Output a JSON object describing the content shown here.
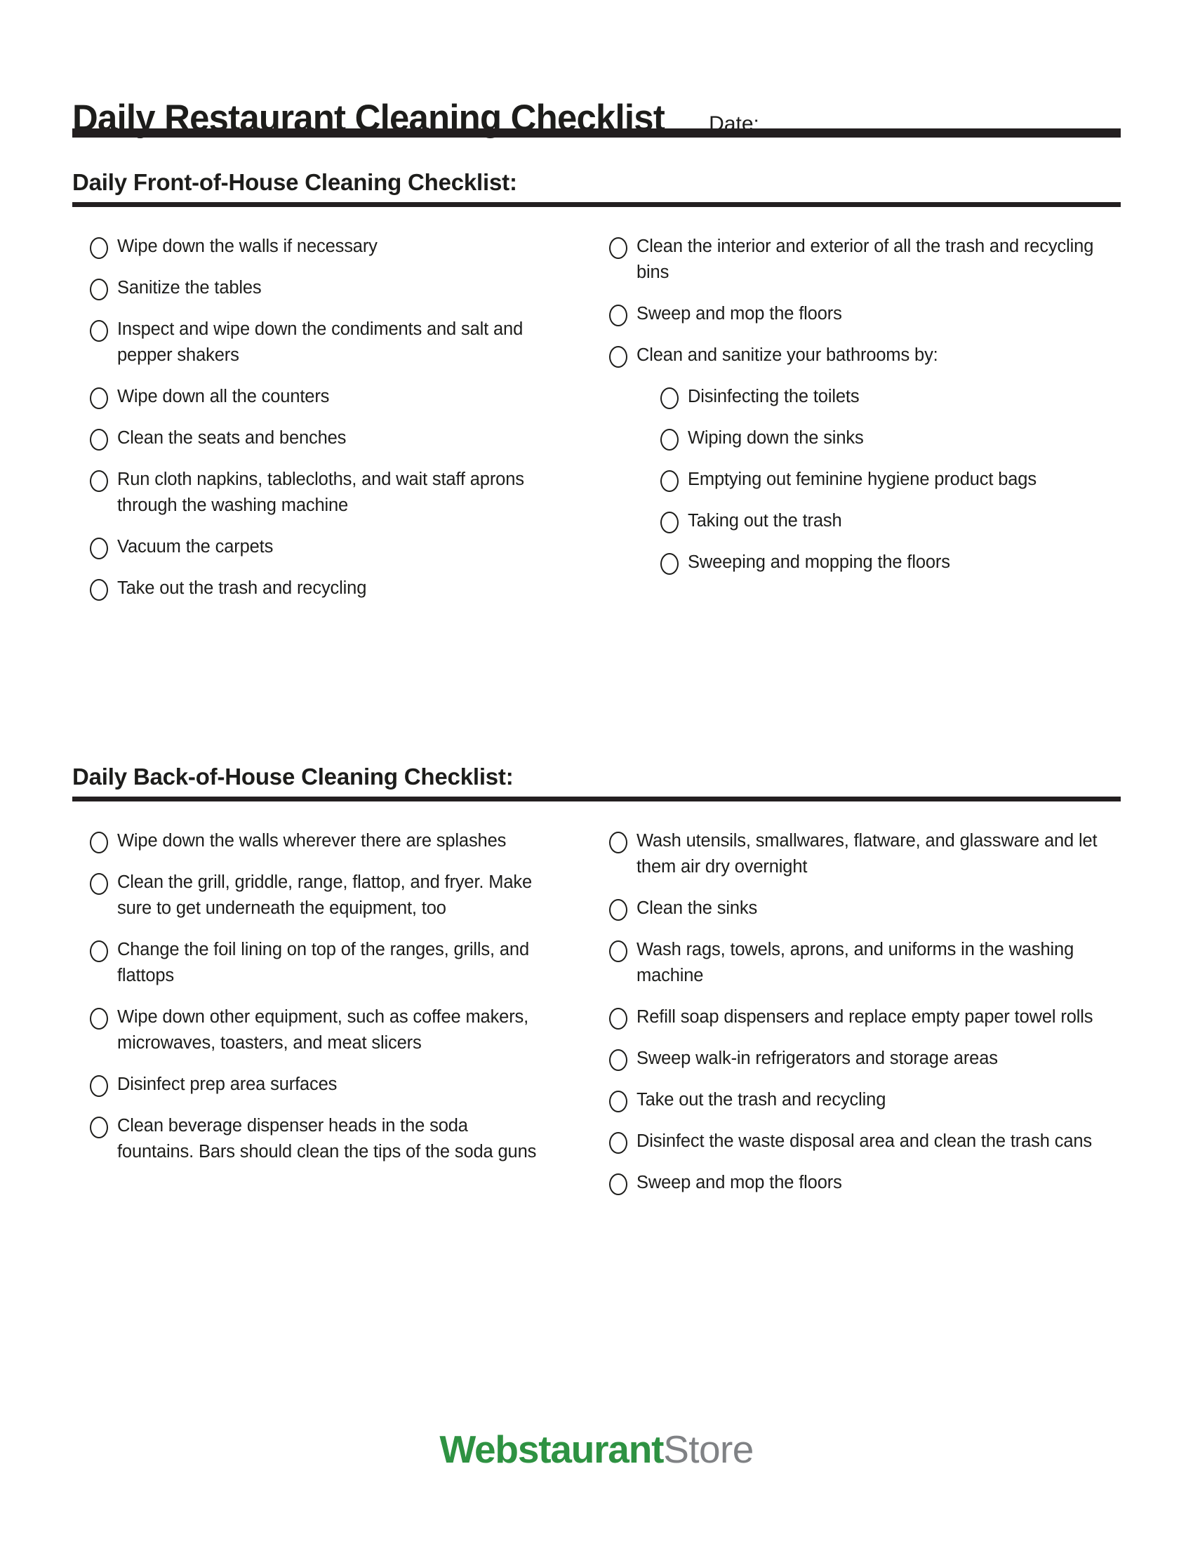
{
  "document": {
    "title": "Daily Restaurant Cleaning Checklist",
    "date_label": "Date:",
    "date_value": ""
  },
  "colors": {
    "rule": "#231f20",
    "text": "#1d1d1b",
    "logo_green": "#2e9242",
    "logo_gray": "#808285"
  },
  "sections": [
    {
      "heading": "Daily Front-of-House Cleaning Checklist:",
      "left_column": [
        {
          "label": "Wipe down the walls if necessary",
          "level": 0
        },
        {
          "label": "Sanitize the tables",
          "level": 0
        },
        {
          "label": "Inspect and wipe down the condiments and salt and pepper shakers",
          "level": 0
        },
        {
          "label": "Wipe down all the counters",
          "level": 0
        },
        {
          "label": "Clean the seats and benches",
          "level": 0
        },
        {
          "label": "Run cloth napkins, tablecloths, and wait staff aprons through the washing machine",
          "level": 0
        },
        {
          "label": "Vacuum the carpets",
          "level": 0
        },
        {
          "label": "Take out the trash and recycling",
          "level": 0
        }
      ],
      "right_column": [
        {
          "label": "Clean the interior and exterior of all the trash and recycling bins",
          "level": 0
        },
        {
          "label": "Sweep and mop the floors",
          "level": 0
        },
        {
          "label": "Clean and sanitize your bathrooms by:",
          "level": 0
        },
        {
          "label": "Disinfecting the toilets",
          "level": 1
        },
        {
          "label": "Wiping down the sinks",
          "level": 1
        },
        {
          "label": "Emptying out feminine hygiene product bags",
          "level": 1
        },
        {
          "label": "Taking out the trash",
          "level": 1
        },
        {
          "label": "Sweeping and mopping the floors",
          "level": 1
        }
      ]
    },
    {
      "heading": "Daily Back-of-House Cleaning Checklist:",
      "left_column": [
        {
          "label": "Wipe down the walls wherever there are splashes",
          "level": 0
        },
        {
          "label": "Clean the grill, griddle, range, flattop, and fryer. Make sure to get underneath the equipment, too",
          "level": 0
        },
        {
          "label": "Change the foil lining on top of the ranges, grills, and flattops",
          "level": 0
        },
        {
          "label": "Wipe down other equipment, such as coffee makers, microwaves, toasters, and meat slicers",
          "level": 0
        },
        {
          "label": "Disinfect prep area surfaces",
          "level": 0
        },
        {
          "label": "Clean beverage dispenser heads in the soda fountains. Bars should clean the tips of the soda guns",
          "level": 0
        }
      ],
      "right_column": [
        {
          "label": "Wash utensils, smallwares, flatware, and glassware and let them air dry overnight",
          "level": 0
        },
        {
          "label": "Clean the sinks",
          "level": 0
        },
        {
          "label": "Wash rags, towels, aprons, and uniforms in the washing machine",
          "level": 0
        },
        {
          "label": "Refill soap dispensers and replace empty paper towel rolls",
          "level": 0
        },
        {
          "label": "Sweep walk-in refrigerators and storage areas",
          "level": 0
        },
        {
          "label": "Take out the trash and recycling",
          "level": 0
        },
        {
          "label": "Disinfect the waste disposal area and clean the trash cans",
          "level": 0
        },
        {
          "label": "Sweep and mop the floors",
          "level": 0
        }
      ]
    }
  ],
  "logo": {
    "primary": "Webstaurant",
    "secondary": "Store"
  }
}
